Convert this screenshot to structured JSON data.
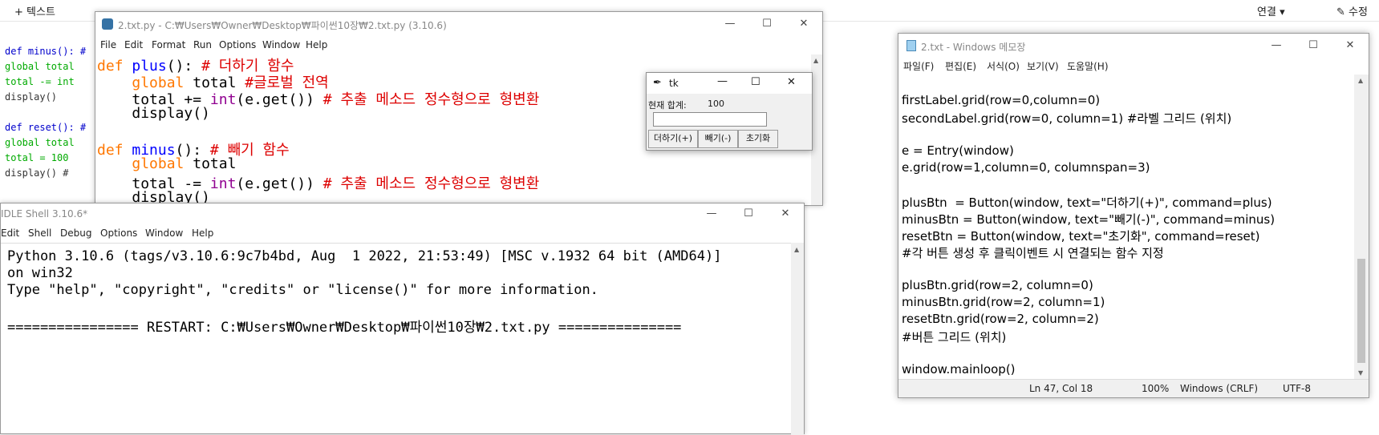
{
  "background": {
    "topbar": {
      "left_text": "+ 텍스트",
      "connect_label": "연결",
      "edit_label": "수정"
    },
    "editor_lines": [
      {
        "text": "def minus(): #",
        "color": "#0000cc"
      },
      {
        "text": "  global total",
        "color": "#0a0"
      },
      {
        "text": "  total -= int",
        "color": "#0a0"
      },
      {
        "text": "  display()",
        "color": "#333"
      },
      {
        "text": "",
        "color": "#333"
      },
      {
        "text": "def reset(): #",
        "color": "#0000cc"
      },
      {
        "text": "  global total",
        "color": "#0a0"
      },
      {
        "text": "  total = 100",
        "color": "#0a0"
      },
      {
        "text": "  display() #",
        "color": "#333"
      }
    ]
  },
  "idle_editor": {
    "title": "2.txt.py - C:₩Users₩Owner₩Desktop₩파이썬10장₩2.txt.py (3.10.6)",
    "menu": [
      "File",
      "Edit",
      "Format",
      "Run",
      "Options",
      "Window",
      "Help"
    ],
    "code": {
      "l1_def": "def",
      "l1_name": "plus",
      "l1_rest": "(): ",
      "l1_comment": "# 더하기 함수",
      "l2_global": "global",
      "l2_rest": " total ",
      "l2_comment": "#글로벌 전역",
      "l3_pre": "total += ",
      "l3_int": "int",
      "l3_rest": "(e.get()) ",
      "l3_comment": "# 추출 메소드 정수형으로 형변환",
      "l4": "display()",
      "l6_def": "def",
      "l6_name": "minus",
      "l6_rest": "(): ",
      "l6_comment": "# 빼기 함수",
      "l7_global": "global",
      "l7_rest": " total",
      "l8_pre": "total -= ",
      "l8_int": "int",
      "l8_rest": "(e.get()) ",
      "l8_comment": "# 추출 메소드 정수형으로 형변환",
      "l9": "display()"
    }
  },
  "tk_window": {
    "title": "tk",
    "label_left": "현재 합계:",
    "label_right": "100",
    "entry_value": "",
    "buttons": [
      "더하기(+)",
      "빼기(-)",
      "초기화"
    ]
  },
  "shell": {
    "title": "IDLE Shell 3.10.6*",
    "menu": [
      "Edit",
      "Shell",
      "Debug",
      "Options",
      "Window",
      "Help"
    ],
    "lines": [
      "Python 3.10.6 (tags/v3.10.6:9c7b4bd, Aug  1 2022, 21:53:49) [MSC v.1932 64 bit (AMD64)]",
      "on win32",
      "Type \"help\", \"copyright\", \"credits\" or \"license()\" for more information.",
      "",
      "================ RESTART: C:₩Users₩Owner₩Desktop₩파이썬10장₩2.txt.py ==============="
    ]
  },
  "notepad": {
    "title": "2.txt - Windows 메모장",
    "menu": [
      "파일(F)",
      "편집(E)",
      "서식(O)",
      "보기(V)",
      "도움말(H)"
    ],
    "lines": [
      "",
      "firstLabel.grid(row=0,column=0)",
      "secondLabel.grid(row=0, column=1) #라벨 그리드 (위치)",
      "",
      "e = Entry(window)",
      "e.grid(row=1,column=0, columnspan=3)",
      "",
      "plusBtn  = Button(window, text=\"더하기(+)\", command=plus)",
      "minusBtn = Button(window, text=\"빼기(-)\", command=minus)",
      "resetBtn = Button(window, text=\"초기화\", command=reset)",
      "#각 버튼 생성 후 클릭이벤트 시 연결되는 함수 지정",
      "",
      "plusBtn.grid(row=2, column=0)",
      "minusBtn.grid(row=2, column=1)",
      "resetBtn.grid(row=2, column=2)",
      "#버튼 그리드 (위치)",
      "",
      "window.mainloop()"
    ],
    "status": {
      "position": "Ln 47, Col 18",
      "zoom": "100%",
      "line_ending": "Windows (CRLF)",
      "encoding": "UTF-8"
    }
  }
}
